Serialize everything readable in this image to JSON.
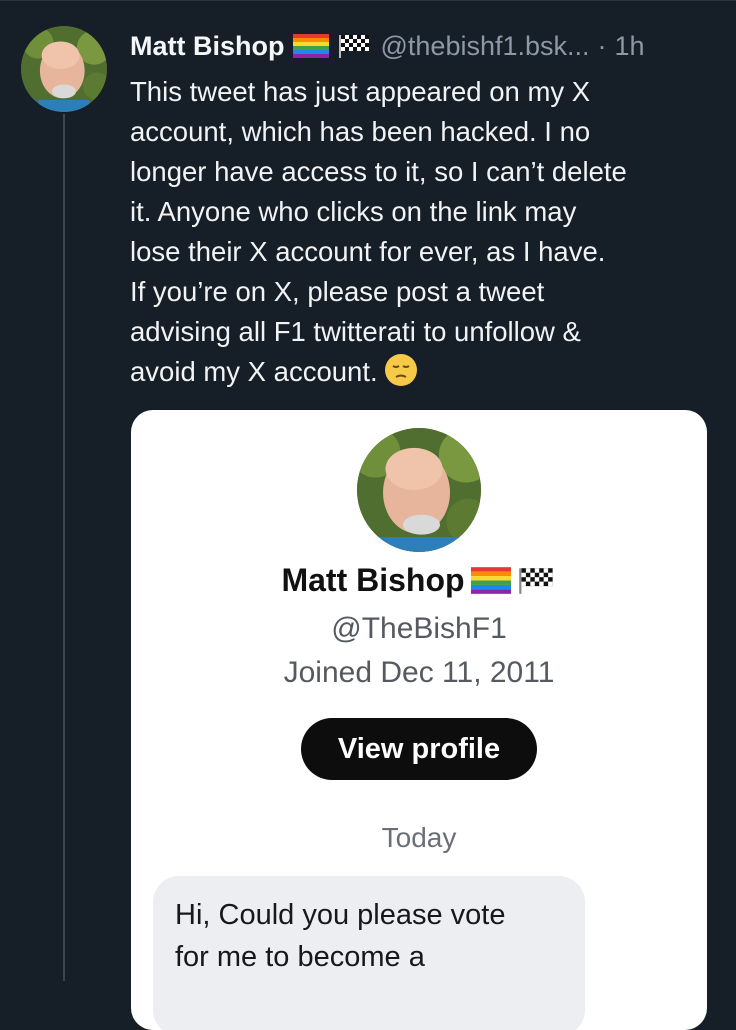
{
  "post": {
    "author_name": "Matt Bishop",
    "handle": "@thebishf1.bsk...",
    "separator": "·",
    "time": "1h",
    "body_lines": [
      "This tweet has just appeared on my X",
      "account, which has been hacked. I no",
      "longer have access to it, so I can’t delete",
      "it. Anyone who clicks on the link may",
      "lose their X account for ever, as I have.",
      "If you’re on X, please post a tweet",
      "advising all F1 twitterati to unfollow &",
      "avoid my X account."
    ],
    "icons": [
      "rainbow-flag-icon",
      "checkered-flag-icon",
      "pensive-face-icon"
    ]
  },
  "embed": {
    "name": "Matt Bishop",
    "handle": "@TheBishF1",
    "joined": "Joined Dec 11, 2011",
    "view_profile_label": "View profile",
    "day_label": "Today",
    "message_lines": [
      "Hi, Could you please vote",
      "for me to become a"
    ]
  },
  "colors": {
    "background": "#161e27",
    "text_primary": "#f1f3f5",
    "text_secondary": "#8d99a6",
    "card_background": "#ffffff",
    "button_background": "#0d0d0d",
    "bubble_background": "#eceef1"
  }
}
